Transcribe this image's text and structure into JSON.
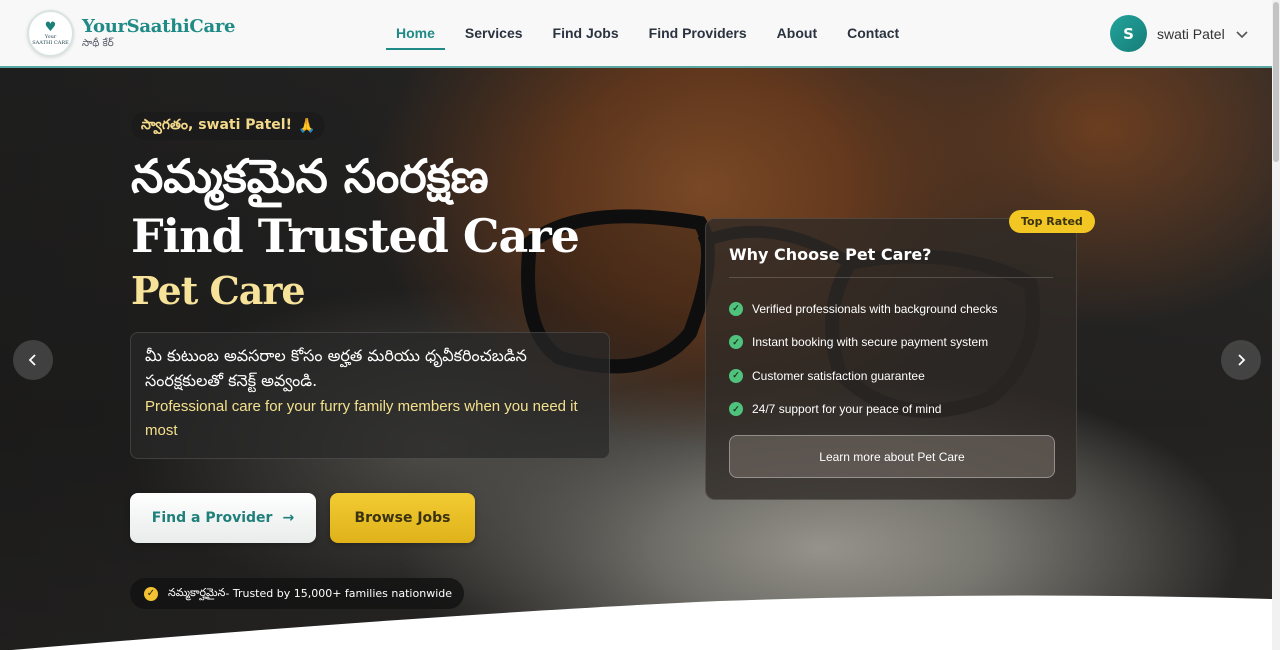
{
  "brand": {
    "title": "YourSaathiCare",
    "subtitle": "సాథీ కేర్",
    "badge_line1": "Your",
    "badge_line2": "SAATHI CARE"
  },
  "nav": {
    "items": [
      {
        "label": "Home",
        "active": true
      },
      {
        "label": "Services",
        "active": false
      },
      {
        "label": "Find Jobs",
        "active": false
      },
      {
        "label": "Find Providers",
        "active": false
      },
      {
        "label": "About",
        "active": false
      },
      {
        "label": "Contact",
        "active": false
      }
    ]
  },
  "user": {
    "initial": "S",
    "name": "swati Patel"
  },
  "hero": {
    "welcome": "స్వాగతం, swati Patel!",
    "welcome_icon": "🙏",
    "heading_telugu": "నమ్మకమైన సంరక్షణ",
    "heading_english": "Find Trusted Care",
    "heading_category": "Pet Care",
    "description_telugu": "మీ కుటుంబ అవసరాల కోసం అర్హత మరియు ధృవీకరించబడిన సంరక్షకులతో కనెక్ట్ అవ్వండి.",
    "description_english": "Professional care for your furry family members when you need it most",
    "btn_find_provider": "Find a Provider",
    "btn_browse_jobs": "Browse Jobs",
    "trust_telugu": "నమ్మకార్హమైన",
    "trust_text": " - Trusted by 15,000+ families nationwide",
    "prev_icon": "chevron-left-icon",
    "next_icon": "chevron-right-icon"
  },
  "why_card": {
    "badge": "Top Rated",
    "title": "Why Choose Pet Care?",
    "features": [
      "Verified professionals with background checks",
      "Instant booking with secure payment system",
      "Customer satisfaction guarantee",
      "24/7 support for your peace of mind"
    ],
    "learn_more": "Learn more about Pet Care"
  },
  "colors": {
    "brand_teal": "#1f8a86",
    "accent_yellow": "#f2c623",
    "highlight_text": "#f7e29a",
    "check_green": "#4fc27c"
  }
}
